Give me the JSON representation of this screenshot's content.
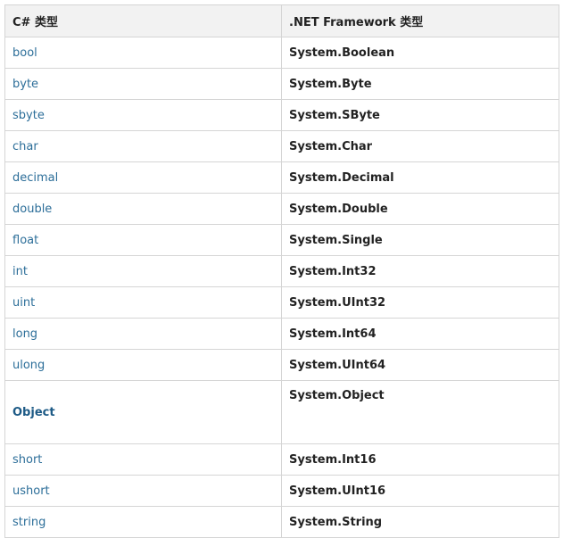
{
  "table": {
    "headers": [
      "C# 类型",
      ".NET Framework 类型"
    ],
    "rows": [
      {
        "cs": "bool",
        "net": "System.Boolean"
      },
      {
        "cs": "byte",
        "net": "System.Byte"
      },
      {
        "cs": "sbyte",
        "net": "System.SByte"
      },
      {
        "cs": "char",
        "net": "System.Char"
      },
      {
        "cs": "decimal",
        "net": "System.Decimal"
      },
      {
        "cs": "double",
        "net": "System.Double"
      },
      {
        "cs": "float",
        "net": "System.Single"
      },
      {
        "cs": "int",
        "net": "System.Int32"
      },
      {
        "cs": "uint",
        "net": "System.UInt32"
      },
      {
        "cs": "long",
        "net": "System.Int64"
      },
      {
        "cs": "ulong",
        "net": "System.UInt64"
      },
      {
        "cs": "Object",
        "net": "System.Object"
      },
      {
        "cs": "short",
        "net": "System.Int16"
      },
      {
        "cs": "ushort",
        "net": "System.UInt16"
      },
      {
        "cs": "string",
        "net": "System.String"
      }
    ]
  },
  "colors": {
    "link": "#2c6e99",
    "header_bg": "#f2f2f2",
    "border": "#d5d5d5"
  }
}
